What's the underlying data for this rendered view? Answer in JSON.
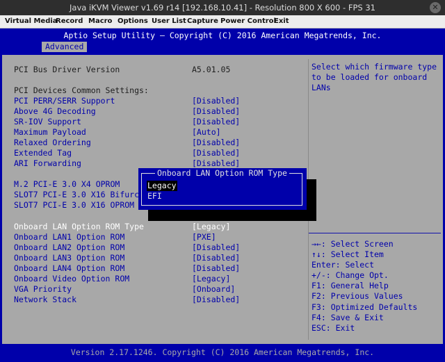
{
  "window": {
    "title": "Java iKVM Viewer v1.69 r14 [192.168.10.41]  - Resolution 800 X 600 - FPS 31",
    "close_glyph": "✕"
  },
  "menu": [
    "Virtual Media",
    "Record",
    "Macro",
    "Options",
    "User List",
    "Capture",
    "Power Control",
    "Exit"
  ],
  "bios": {
    "title": "Aptio Setup Utility – Copyright (C) 2016 American Megatrends, Inc.",
    "tab": "Advanced",
    "footer": "Version 2.17.1246. Copyright (C) 2016 American Megatrends, Inc.",
    "help_text": "Select which firmware type to be loaded for onboard LANs",
    "keys": [
      "→←: Select Screen",
      "↑↓: Select Item",
      "Enter: Select",
      "+/-: Change Opt.",
      "F1: General Help",
      "F2: Previous Values",
      "F3: Optimized Defaults",
      "F4: Save & Exit",
      "ESC: Exit"
    ],
    "rows": [
      {
        "label": "PCI Bus Driver Version",
        "value": "A5.01.05"
      },
      {
        "label": "PCI Devices Common Settings:",
        "value": ""
      },
      {
        "label": "PCI PERR/SERR Support",
        "value": "[Disabled]"
      },
      {
        "label": "Above 4G Decoding",
        "value": "[Disabled]"
      },
      {
        "label": "SR-IOV Support",
        "value": "[Disabled]"
      },
      {
        "label": "Maximum Payload",
        "value": "[Auto]"
      },
      {
        "label": "Relaxed Ordering",
        "value": "[Disabled]"
      },
      {
        "label": "Extended Tag",
        "value": "[Disabled]"
      },
      {
        "label": "ARI Forwarding",
        "value": "[Disabled]"
      },
      {
        "label": "M.2 PCI-E 3.0 X4 OPROM",
        "value": ""
      },
      {
        "label": "SLOT7 PCI-E 3.0 X16 Bifurcat",
        "value": ""
      },
      {
        "label": "SLOT7 PCI-E 3.0 X16 OPROM",
        "value": ""
      },
      {
        "label": "Onboard LAN Option ROM Type",
        "value": "[Legacy]"
      },
      {
        "label": "Onboard LAN1 Option ROM",
        "value": "[PXE]"
      },
      {
        "label": "Onboard LAN2 Option ROM",
        "value": "[Disabled]"
      },
      {
        "label": "Onboard LAN3 Option ROM",
        "value": "[Disabled]"
      },
      {
        "label": "Onboard LAN4 Option ROM",
        "value": "[Disabled]"
      },
      {
        "label": "Onboard Video Option ROM",
        "value": "[Legacy]"
      },
      {
        "label": "VGA Priority",
        "value": "[Onboard]"
      },
      {
        "label": "Network Stack",
        "value": "[Disabled]"
      }
    ],
    "popup": {
      "title": "Onboard LAN Option ROM Type",
      "options": [
        "Legacy",
        "EFI"
      ],
      "selected": "Legacy"
    }
  },
  "colors": {
    "bios_blue": "#0000aa",
    "bios_gray": "#a8a8a8",
    "highlight": "#ffffff"
  }
}
